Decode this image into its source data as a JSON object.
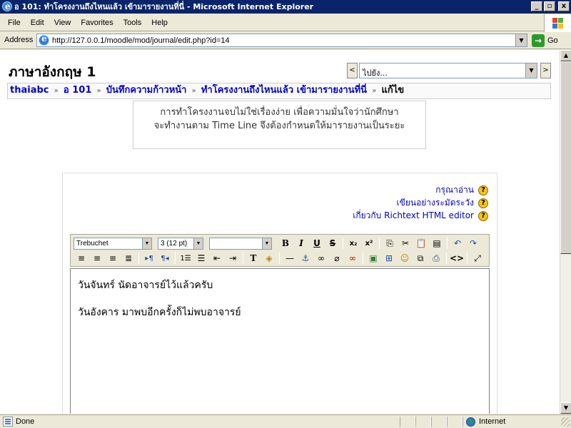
{
  "window": {
    "title": "อ 101: ทำโครงงานถึงไหนแล้ว เข้ามารายงานที่นี่ - Microsoft Internet Explorer",
    "minimize": "_",
    "maximize": "▫",
    "close": "x"
  },
  "menu": {
    "items": [
      "File",
      "Edit",
      "View",
      "Favorites",
      "Tools",
      "Help"
    ]
  },
  "address": {
    "label": "Address",
    "url": "http://127.0.0.1/moodle/mod/journal/edit.php?id=14",
    "go_label": "Go"
  },
  "page": {
    "course_title": "ภาษาอังกฤษ 1",
    "jump_menu": {
      "prev": "<",
      "selected": "ไปยัง...",
      "next": ">"
    },
    "breadcrumb": {
      "items": [
        "thaiabc",
        "อ 101",
        "บันทึกความก้าวหน้า",
        "ทำโครงงานถึงไหนแล้ว เข้ามารายงานที่นี่"
      ],
      "separator": "»",
      "current": "แก้ไข"
    },
    "intro": {
      "line1": "การทำโครงงานจบไม่ใช่เรื่องง่าย เพื่อความมั่นใจว่านักศึกษา",
      "line2": "จะทำงานตาม Time Line จึงต้องกำหนดให้มารายงานเป็นระยะ"
    },
    "help_links": [
      {
        "label": "กรุณาอ่าน"
      },
      {
        "label": "เขียนอย่างระมัดระวัง"
      },
      {
        "label": "เกี่ยวกับ Richtext HTML editor"
      }
    ],
    "help_glyph": "?",
    "editor": {
      "font_select": "Trebuchet",
      "size_select": "3 (12 pt)",
      "style_select": "",
      "lines": [
        "วันจันทร์ นัดอาจารย์ไว้แล้วครับ",
        "วันอังคาร มาพบอีกครั้งก็ไม่พบอาจารย์"
      ]
    }
  },
  "status": {
    "text": "Done",
    "zone": "Internet"
  },
  "colors": {
    "titlebar": "#0a246a",
    "link": "#0000cc",
    "chrome": "#ece9d8"
  }
}
